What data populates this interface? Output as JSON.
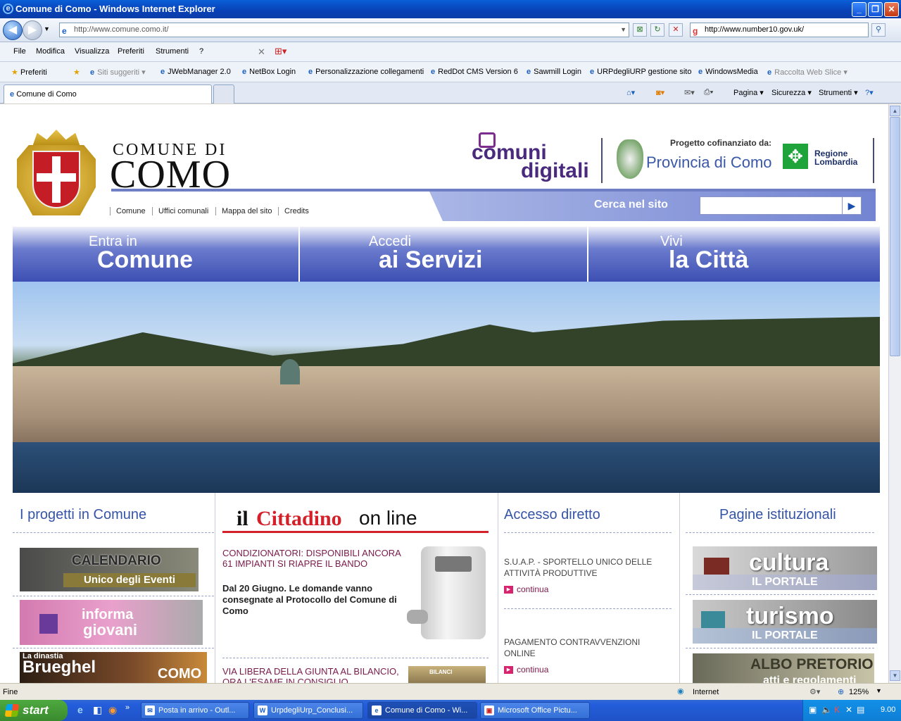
{
  "window": {
    "title": "Comune di Como - Windows Internet Explorer"
  },
  "nav": {
    "url": "http://www.comune.como.it/",
    "search_url": "http://www.number10.gov.uk/"
  },
  "menu": [
    "File",
    "Modifica",
    "Visualizza",
    "Preferiti",
    "Strumenti",
    "?"
  ],
  "favorites": {
    "label": "Preferiti",
    "items": [
      "Siti suggeriti ▾",
      "JWebManager 2.0",
      "NetBox Login",
      "Personalizzazione collegamenti",
      "RedDot CMS Version 6",
      "Sawmill Login",
      "URPdegliURP gestione sito",
      "WindowsMedia",
      "Raccolta Web Slice ▾"
    ]
  },
  "tabs": {
    "active": "Comune di Como"
  },
  "commands": [
    "Pagina ▾",
    "Sicurezza ▾",
    "Strumenti ▾"
  ],
  "site": {
    "logo_line1": "COMUNE DI",
    "logo_line2": "COMO",
    "subnav": [
      "Comune",
      "Uffici comunali",
      "Mappa del sito",
      "Credits"
    ],
    "comuni_digitali": [
      "comuni",
      "digitali"
    ],
    "cofinanziato": "Progetto cofinanziato da:",
    "provincia": "Provincia di Como",
    "regione": [
      "Regione",
      "Lombardia"
    ],
    "search_label": "Cerca nel sito",
    "big_tabs": [
      {
        "small": "Entra in",
        "big": "Comune"
      },
      {
        "small": "Accedi",
        "big": "ai Servizi"
      },
      {
        "small": "Vivi",
        "big": "la Città"
      }
    ],
    "col1": {
      "title": "I progetti in Comune",
      "banners": [
        "CALENDARIO",
        "Unico degli Eventi",
        "informa",
        "giovani",
        "La dinastia",
        "Brueghel",
        "COMO"
      ]
    },
    "col2": {
      "logo_a": "il",
      "logo_b": "Cittadino",
      "logo_c": "on line",
      "news1_title": "CONDIZIONATORI: DISPONIBILI ANCORA 61 IMPIANTI SI RIAPRE IL BANDO",
      "news1_body": "Dal 20 Giugno. Le domande vanno consegnate al Protocollo del Comune di Como",
      "news2_title": "VIA LIBERA DELLA GIUNTA AL BILANCIO, ORA L'ESAME IN CONSIGLIO",
      "news2_img": "BILANCI"
    },
    "col3": {
      "title": "Accesso diretto",
      "items": [
        {
          "text": "S.U.A.P. - SPORTELLO UNICO DELLE ATTIVITÀ PRODUTTIVE",
          "link": "continua"
        },
        {
          "text": "PAGAMENTO CONTRAVVENZIONI ONLINE",
          "link": "continua"
        }
      ]
    },
    "col4": {
      "title": "Pagine istituzionali",
      "banners": [
        {
          "big": "cultura",
          "small": "IL PORTALE"
        },
        {
          "big": "turismo",
          "small": "IL PORTALE"
        },
        {
          "big": "ALBO PRETORIO",
          "small": "atti e regolamenti"
        }
      ]
    }
  },
  "status": {
    "left": "Fine",
    "zone": "Internet",
    "zoom": "125%"
  },
  "taskbar": {
    "start": "start",
    "tasks": [
      "Posta in arrivo - Outl...",
      "UrpdegliUrp_Conclusi...",
      "Comune di Como - Wi...",
      "Microsoft Office Pictu..."
    ],
    "clock": "9.00"
  },
  "colors": {
    "accent": "#3d4fb2",
    "news": "#7a1a4a",
    "title": "#3554a8"
  }
}
